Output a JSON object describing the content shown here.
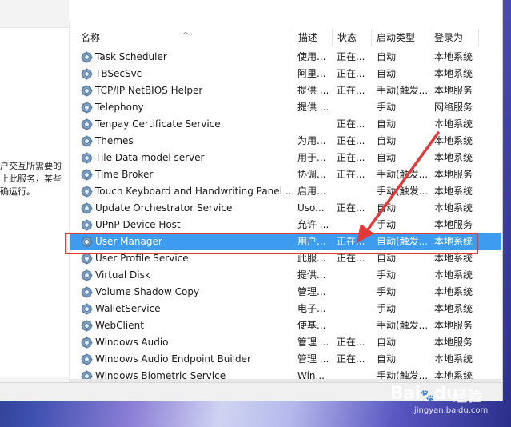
{
  "left_panel": {
    "description_text": "户交互所需要的\n止此服务，某些\n确运行。"
  },
  "columns": {
    "name": "名称",
    "description": "描述",
    "status": "状态",
    "startup_type": "启动类型",
    "log_on_as": "登录为"
  },
  "services": [
    {
      "name": "Task Scheduler",
      "description": "使用...",
      "status": "正在...",
      "startup_type": "自动",
      "log_on_as": "本地系统"
    },
    {
      "name": "TBSecSvc",
      "description": "阿里...",
      "status": "正在...",
      "startup_type": "自动",
      "log_on_as": "本地系统"
    },
    {
      "name": "TCP/IP NetBIOS Helper",
      "description": "提供 ...",
      "status": "正在...",
      "startup_type": "手动(触发...",
      "log_on_as": "本地服务"
    },
    {
      "name": "Telephony",
      "description": "提供 ...",
      "status": "",
      "startup_type": "手动",
      "log_on_as": "网络服务"
    },
    {
      "name": "Tenpay Certificate Service",
      "description": "",
      "status": "正在...",
      "startup_type": "自动",
      "log_on_as": "本地系统"
    },
    {
      "name": "Themes",
      "description": "为用...",
      "status": "正在...",
      "startup_type": "自动",
      "log_on_as": "本地系统"
    },
    {
      "name": "Tile Data model server",
      "description": "用于...",
      "status": "正在...",
      "startup_type": "自动",
      "log_on_as": "本地系统"
    },
    {
      "name": "Time Broker",
      "description": "协调...",
      "status": "正在...",
      "startup_type": "手动(触发...",
      "log_on_as": "本地服务"
    },
    {
      "name": "Touch Keyboard and Handwriting Panel ...",
      "description": "启用...",
      "status": "",
      "startup_type": "手动(触发...",
      "log_on_as": "本地系统"
    },
    {
      "name": "Update Orchestrator Service",
      "description": "Uso...",
      "status": "正在...",
      "startup_type": "自动",
      "log_on_as": "本地系统"
    },
    {
      "name": "UPnP Device Host",
      "description": "允许 ...",
      "status": "",
      "startup_type": "手动",
      "log_on_as": "本地服务"
    },
    {
      "name": "User Manager",
      "description": "用户...",
      "status": "正在...",
      "startup_type": "自动(触发...",
      "log_on_as": "本地系统"
    },
    {
      "name": "User Profile Service",
      "description": "此服...",
      "status": "正在...",
      "startup_type": "自动",
      "log_on_as": "本地系统"
    },
    {
      "name": "Virtual Disk",
      "description": "提供...",
      "status": "",
      "startup_type": "手动",
      "log_on_as": "本地系统"
    },
    {
      "name": "Volume Shadow Copy",
      "description": "管理...",
      "status": "",
      "startup_type": "手动",
      "log_on_as": "本地系统"
    },
    {
      "name": "WalletService",
      "description": "电子...",
      "status": "",
      "startup_type": "手动",
      "log_on_as": "本地系统"
    },
    {
      "name": "WebClient",
      "description": "使基...",
      "status": "",
      "startup_type": "手动(触发...",
      "log_on_as": "本地服务"
    },
    {
      "name": "Windows Audio",
      "description": "管理 ...",
      "status": "正在...",
      "startup_type": "自动",
      "log_on_as": "本地服务"
    },
    {
      "name": "Windows Audio Endpoint Builder",
      "description": "管理 ...",
      "status": "正在...",
      "startup_type": "自动",
      "log_on_as": "本地系统"
    },
    {
      "name": "Windows Biometric Service",
      "description": "Win...",
      "status": "",
      "startup_type": "手动(触发...",
      "log_on_as": "本地系统"
    }
  ],
  "selected_service": "User Manager",
  "colors": {
    "selection": "#3d9bf0",
    "highlight_box": "#e23a3a",
    "arrow": "#e23a3a"
  },
  "watermark": {
    "logo": "Bai",
    "logo_suffix": "du",
    "cn_text": "经验",
    "url": "jingyan.baidu.com"
  }
}
